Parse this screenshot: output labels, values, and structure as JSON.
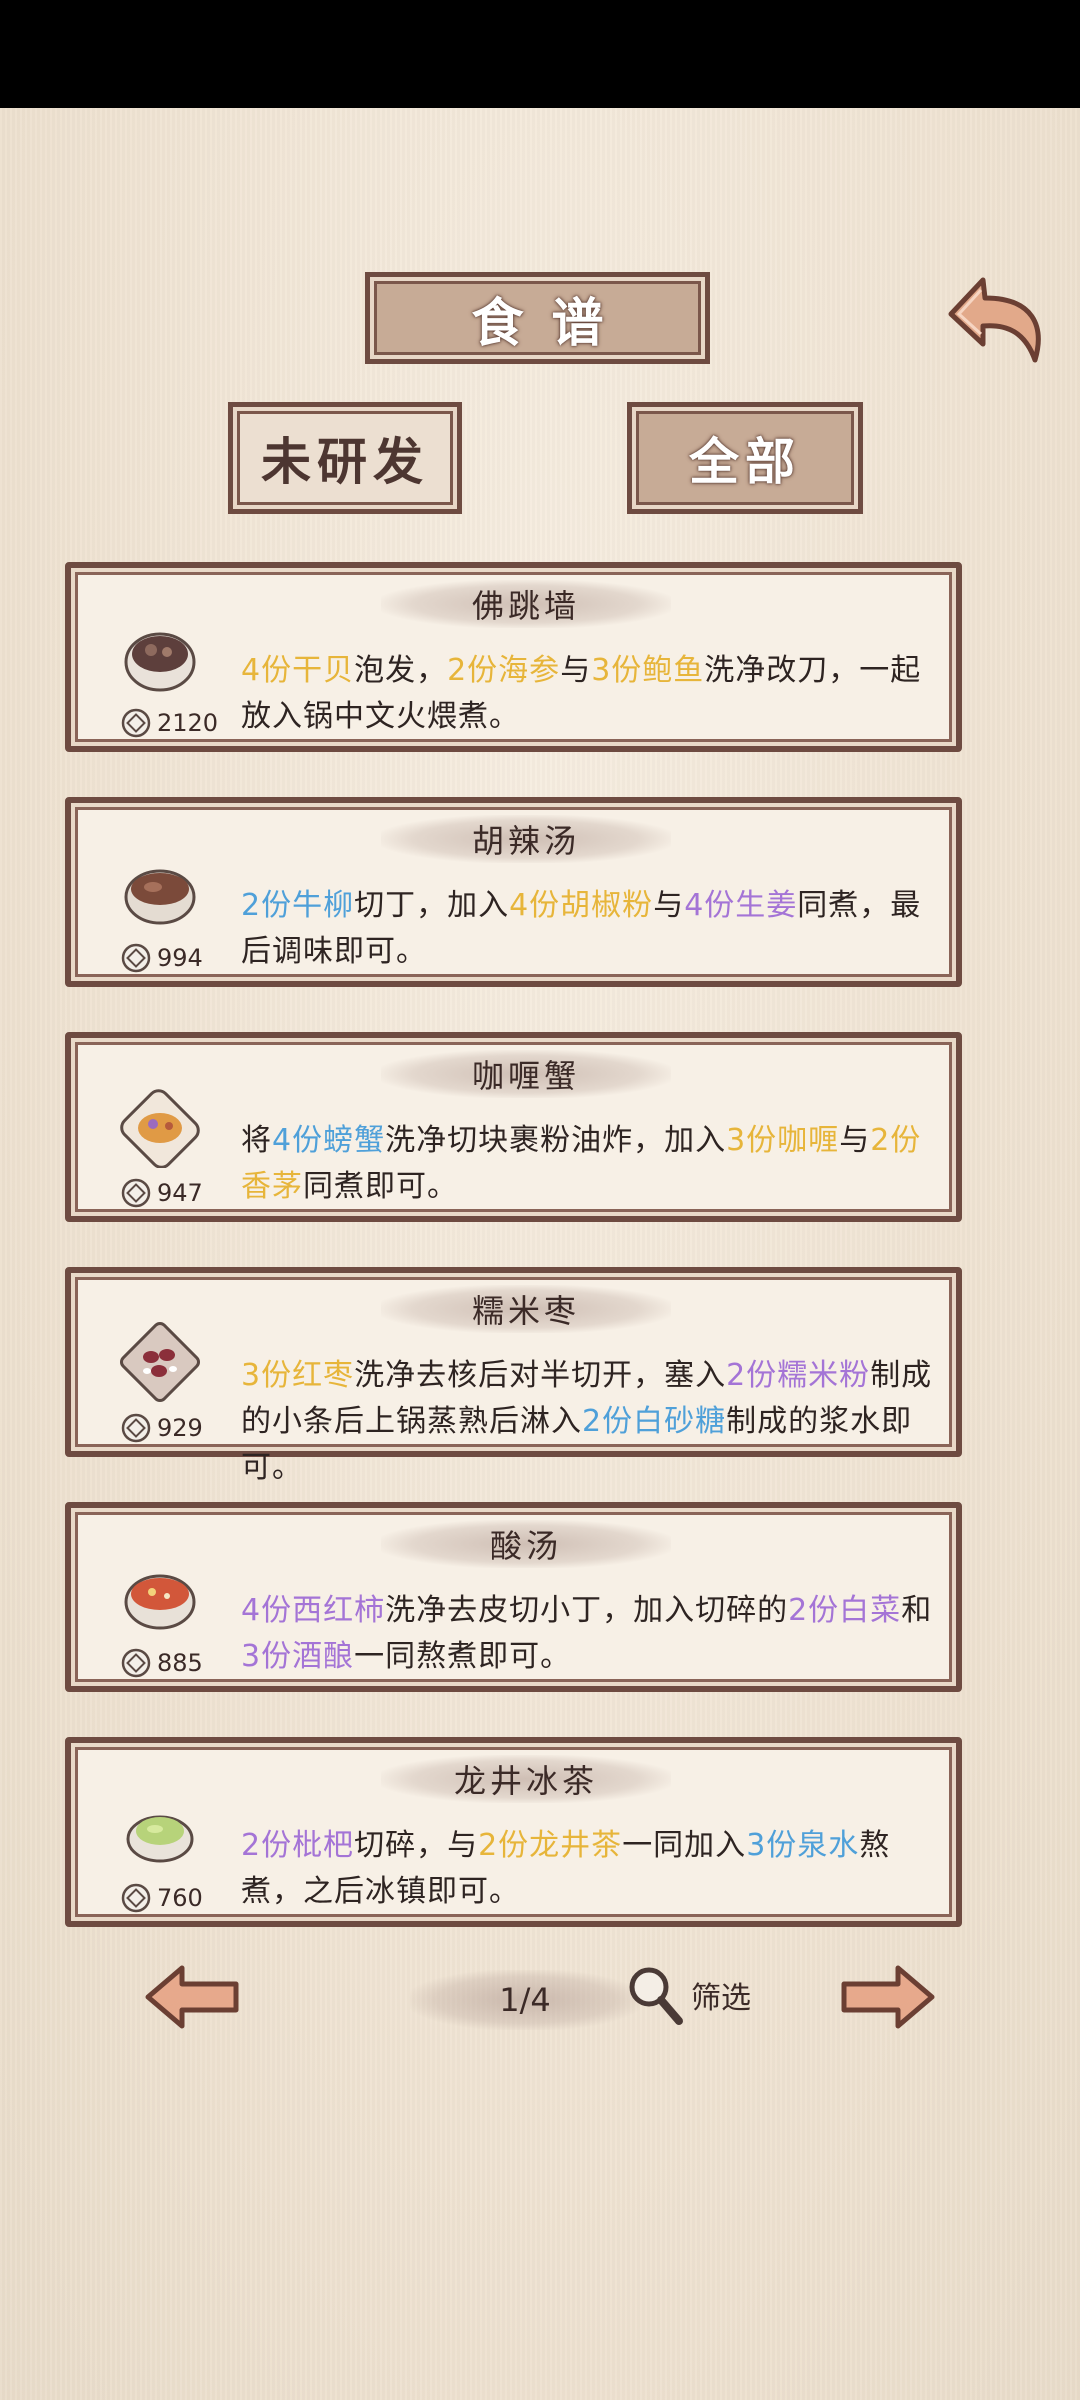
{
  "header": {
    "title": "食谱",
    "tab_undeveloped": "未研发",
    "tab_all": "全部",
    "back_icon": "back-arrow-icon"
  },
  "recipes": [
    {
      "name": "佛跳墙",
      "price": "2120",
      "icon": "buddha-jumps-soup-icon",
      "desc": [
        {
          "t": "4份干贝",
          "c": "y"
        },
        {
          "t": "泡发，",
          "c": ""
        },
        {
          "t": "2份海参",
          "c": "y"
        },
        {
          "t": "与",
          "c": ""
        },
        {
          "t": "3份鲍鱼",
          "c": "y"
        },
        {
          "t": "洗净改刀，一起放入锅中文火煨煮。",
          "c": ""
        }
      ]
    },
    {
      "name": "胡辣汤",
      "price": "994",
      "icon": "spicy-soup-icon",
      "desc": [
        {
          "t": "2份牛柳",
          "c": "b"
        },
        {
          "t": "切丁，加入",
          "c": ""
        },
        {
          "t": "4份胡椒粉",
          "c": "y"
        },
        {
          "t": "与",
          "c": ""
        },
        {
          "t": "4份生姜",
          "c": "p"
        },
        {
          "t": "同煮，最后调味即可。",
          "c": ""
        }
      ]
    },
    {
      "name": "咖喱蟹",
      "price": "947",
      "icon": "curry-crab-icon",
      "desc": [
        {
          "t": "将",
          "c": ""
        },
        {
          "t": "4份螃蟹",
          "c": "b"
        },
        {
          "t": "洗净切块裹粉油炸，加入",
          "c": ""
        },
        {
          "t": "3份咖喱",
          "c": "y"
        },
        {
          "t": "与",
          "c": ""
        },
        {
          "t": "2份香茅",
          "c": "y"
        },
        {
          "t": "同煮即可。",
          "c": ""
        }
      ]
    },
    {
      "name": "糯米枣",
      "price": "929",
      "icon": "glutinous-rice-dates-icon",
      "desc": [
        {
          "t": "3份红枣",
          "c": "y"
        },
        {
          "t": "洗净去核后对半切开，塞入",
          "c": ""
        },
        {
          "t": "2份糯米粉",
          "c": "p"
        },
        {
          "t": "制成的小条后上锅蒸熟后淋入",
          "c": ""
        },
        {
          "t": "2份白砂糖",
          "c": "b"
        },
        {
          "t": "制成的浆水即可。",
          "c": ""
        }
      ]
    },
    {
      "name": "酸汤",
      "price": "885",
      "icon": "sour-soup-icon",
      "desc": [
        {
          "t": "4份西红柿",
          "c": "p"
        },
        {
          "t": "洗净去皮切小丁，加入切碎的",
          "c": ""
        },
        {
          "t": "2份白菜",
          "c": "p"
        },
        {
          "t": "和",
          "c": ""
        },
        {
          "t": "3份酒酿",
          "c": "p"
        },
        {
          "t": "一同熬煮即可。",
          "c": ""
        }
      ]
    },
    {
      "name": "龙井冰茶",
      "price": "760",
      "icon": "longjing-iced-tea-icon",
      "desc": [
        {
          "t": "2份枇杷",
          "c": "p"
        },
        {
          "t": "切碎，与",
          "c": ""
        },
        {
          "t": "2份龙井茶",
          "c": "y"
        },
        {
          "t": "一同加入",
          "c": ""
        },
        {
          "t": "3份泉水",
          "c": "b"
        },
        {
          "t": "熬煮，之后冰镇即可。",
          "c": ""
        }
      ]
    }
  ],
  "footer": {
    "page": "1/4",
    "filter_label": "筛选",
    "prev_icon": "left-arrow-icon",
    "next_icon": "right-arrow-icon",
    "filter_icon": "magnifier-icon"
  },
  "colors": {
    "ingredient_yellow": "#e7b53a",
    "ingredient_blue": "#4fa0d9",
    "ingredient_purple": "#a474d6",
    "frame_brown": "#6e4b41"
  }
}
